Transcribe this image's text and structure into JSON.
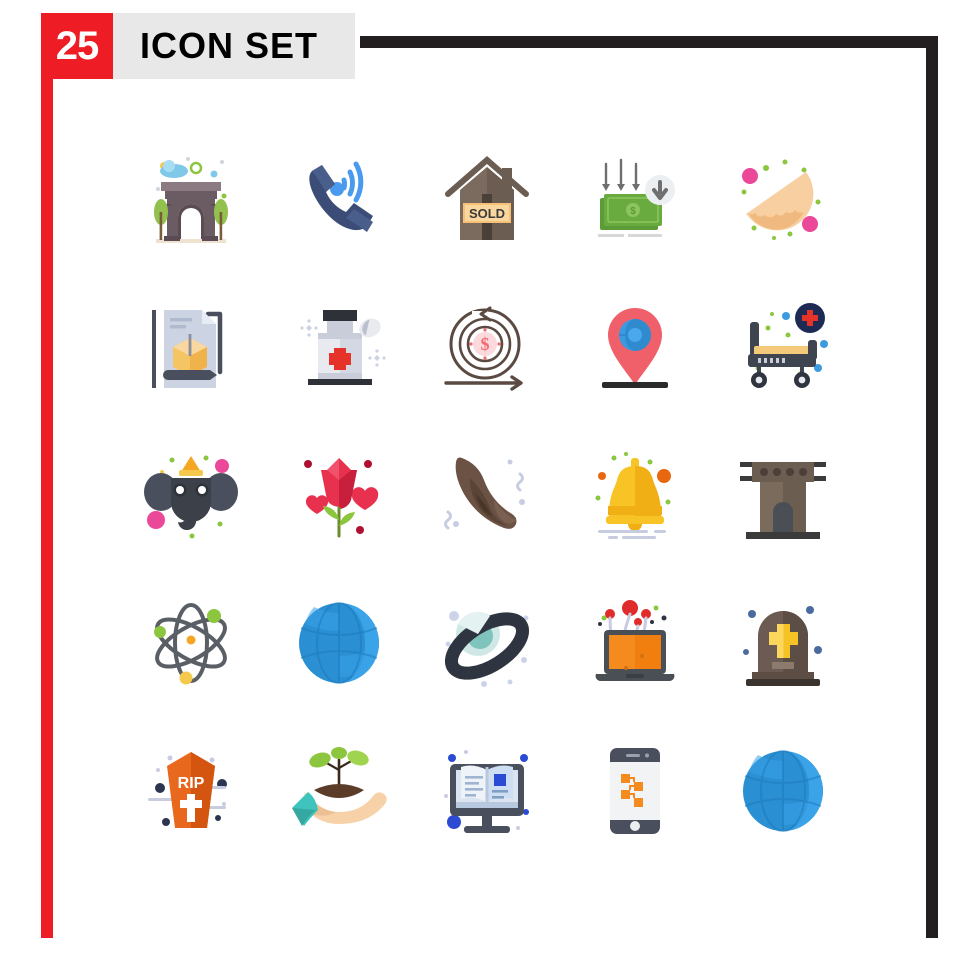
{
  "header": {
    "badge_count": "25",
    "title": "ICON SET",
    "badge_color": "#ee1c25",
    "bar_color": "#e8e8e8",
    "frame_color": "#231f20"
  },
  "grid": {
    "columns": 5,
    "rows": 5,
    "total": 25
  },
  "icons": [
    {
      "name": "arc-de-triomphe-icon",
      "label": "Arc de Triomphe",
      "row": 1,
      "col": 1,
      "colors": [
        "#6b5b62",
        "#8c7a82",
        "#92c14d",
        "#7fc8e8",
        "#f5c94c"
      ]
    },
    {
      "name": "phone-call-signal-icon",
      "label": "Phone Call Signal",
      "row": 1,
      "col": 2,
      "colors": [
        "#3b4c76",
        "#4a5e8c",
        "#4a9bf0"
      ]
    },
    {
      "name": "house-sold-icon",
      "label": "House Sold",
      "row": 1,
      "col": 3,
      "colors": [
        "#7a6b5e",
        "#6b5d52",
        "#f7c077",
        "#3b3b3b"
      ]
    },
    {
      "name": "money-decrease-icon",
      "label": "Money Decrease",
      "row": 1,
      "col": 4,
      "colors": [
        "#6aab3f",
        "#5d9b38",
        "#808080",
        "#e8e8e8"
      ]
    },
    {
      "name": "empanada-icon",
      "label": "Empanada",
      "row": 1,
      "col": 5,
      "colors": [
        "#f7cfa0",
        "#f0b97f",
        "#ec4899",
        "#8cc63f"
      ]
    },
    {
      "name": "package-document-icon",
      "label": "Package Document",
      "row": 2,
      "col": 1,
      "colors": [
        "#ccd3e3",
        "#f5c563",
        "#f0b24a",
        "#4a4f5e"
      ]
    },
    {
      "name": "medicine-bottle-icon",
      "label": "Medicine Bottle",
      "row": 2,
      "col": 2,
      "colors": [
        "#e8eaf0",
        "#c8cdd9",
        "#e63329",
        "#2e3138"
      ]
    },
    {
      "name": "money-target-cycle-icon",
      "label": "Money Target Cycle",
      "row": 2,
      "col": 3,
      "colors": [
        "#5a4a42",
        "#f06a72",
        "#fbd9dc"
      ]
    },
    {
      "name": "location-globe-pin-icon",
      "label": "Location Globe Pin",
      "row": 2,
      "col": 4,
      "colors": [
        "#f0606b",
        "#3b9ae0",
        "#2b2b2b"
      ]
    },
    {
      "name": "hospital-stretcher-icon",
      "label": "Hospital Stretcher",
      "row": 2,
      "col": 5,
      "colors": [
        "#3e4551",
        "#f5c97a",
        "#1d2b54",
        "#e63329",
        "#3b9ae0"
      ]
    },
    {
      "name": "elephant-icon",
      "label": "Elephant",
      "row": 3,
      "col": 1,
      "colors": [
        "#4a4f5e",
        "#3b4049",
        "#f5a623",
        "#ec4899",
        "#8cc63f"
      ]
    },
    {
      "name": "rose-flower-icon",
      "label": "Rose Flower",
      "row": 3,
      "col": 2,
      "colors": [
        "#e8314f",
        "#c81f3c",
        "#8cc63f",
        "#b01030"
      ]
    },
    {
      "name": "croissant-icon",
      "label": "Croissant",
      "row": 3,
      "col": 3,
      "colors": [
        "#6b5244",
        "#5a4436",
        "#4a3529",
        "#c8cce0"
      ]
    },
    {
      "name": "bell-icon",
      "label": "Bell",
      "row": 3,
      "col": 4,
      "colors": [
        "#f7c325",
        "#f0b015",
        "#e8680f",
        "#8cc63f"
      ]
    },
    {
      "name": "watchtower-icon",
      "label": "Watchtower",
      "row": 3,
      "col": 5,
      "colors": [
        "#7a6b5c",
        "#6b5d4f",
        "#3b3b3b",
        "#4a4f55"
      ]
    },
    {
      "name": "atom-icon",
      "label": "Atom",
      "row": 4,
      "col": 1,
      "colors": [
        "#5a5f66",
        "#8cc63f",
        "#f5a623",
        "#f5c94c"
      ]
    },
    {
      "name": "globe-icon",
      "label": "Globe",
      "row": 4,
      "col": 2,
      "colors": [
        "#2b8fd4",
        "#3ba3e8",
        "#1d7ab8"
      ]
    },
    {
      "name": "planet-ring-icon",
      "label": "Planet With Ring",
      "row": 4,
      "col": 3,
      "colors": [
        "#2e3440",
        "#cfe8e5",
        "#7ec4bd",
        "#c8cce0"
      ]
    },
    {
      "name": "laptop-virus-icon",
      "label": "Laptop Virus",
      "row": 4,
      "col": 4,
      "colors": [
        "#4a4f55",
        "#f58a1e",
        "#e02b2b",
        "#8cc63f"
      ]
    },
    {
      "name": "gravestone-icon",
      "label": "Gravestone",
      "row": 4,
      "col": 5,
      "colors": [
        "#6b5b52",
        "#5c4d45",
        "#f5c325",
        "#4a6b9e"
      ]
    },
    {
      "name": "rip-coffin-icon",
      "label": "RIP Coffin",
      "row": 5,
      "col": 1,
      "colors": [
        "#e8681e",
        "#d4550f",
        "#ffffff",
        "#2b3550"
      ]
    },
    {
      "name": "hand-sprout-icon",
      "label": "Hand With Sprout",
      "row": 5,
      "col": 2,
      "colors": [
        "#f7d2a8",
        "#3fc4bd",
        "#8cc63f",
        "#5a3c28"
      ]
    },
    {
      "name": "monitor-book-icon",
      "label": "Monitor With Book",
      "row": 5,
      "col": 3,
      "colors": [
        "#4a4f5e",
        "#dbe4f0",
        "#b8c8de",
        "#2b4bd4"
      ]
    },
    {
      "name": "mobile-sitemap-icon",
      "label": "Mobile Sitemap",
      "row": 5,
      "col": 4,
      "colors": [
        "#4a4f5e",
        "#f0f0f0",
        "#f58a1e"
      ]
    },
    {
      "name": "globe-icon-2",
      "label": "Globe",
      "row": 5,
      "col": 5,
      "colors": [
        "#2b8fd4",
        "#3ba3e8",
        "#1d7ab8"
      ]
    }
  ]
}
